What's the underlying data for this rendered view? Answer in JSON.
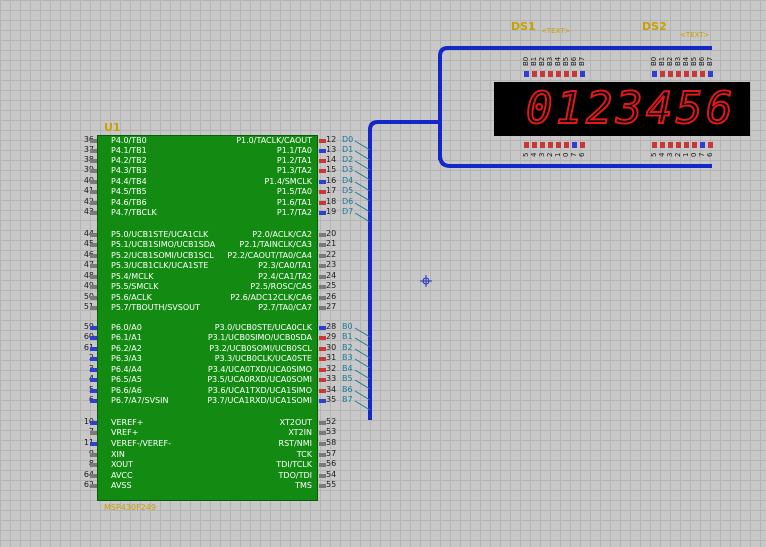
{
  "chip": {
    "ref": "U1",
    "part": "MSP430F249",
    "left_pins": [
      {
        "num": "36",
        "name": "P4.0/TB0",
        "pin": "gray"
      },
      {
        "num": "37",
        "name": "P4.1/TB1",
        "pin": "gray"
      },
      {
        "num": "38",
        "name": "P4.2/TB2",
        "pin": "gray"
      },
      {
        "num": "39",
        "name": "P4.3/TB3",
        "pin": "gray"
      },
      {
        "num": "40",
        "name": "P4.4/TB4",
        "pin": "gray"
      },
      {
        "num": "41",
        "name": "P4.5/TB5",
        "pin": "gray"
      },
      {
        "num": "42",
        "name": "P4.6/TB6",
        "pin": "gray"
      },
      {
        "num": "43",
        "name": "P4.7/TBCLK",
        "pin": "gray"
      },
      {
        "num": "44",
        "name": "P5.0/UCB1STE/UCA1CLK",
        "pin": "gray"
      },
      {
        "num": "45",
        "name": "P5.1/UCB1SIMO/UCB1SDA",
        "pin": "gray"
      },
      {
        "num": "46",
        "name": "P5.2/UCB1SOMI/UCB1SCL",
        "pin": "gray"
      },
      {
        "num": "47",
        "name": "P5.3/UCB1CLK/UCA1STE",
        "pin": "gray"
      },
      {
        "num": "48",
        "name": "P5.4/MCLK",
        "pin": "gray"
      },
      {
        "num": "49",
        "name": "P5.5/SMCLK",
        "pin": "gray"
      },
      {
        "num": "50",
        "name": "P5.6/ACLK",
        "pin": "gray"
      },
      {
        "num": "51",
        "name": "P5.7/TBOUTH/SVSOUT",
        "pin": "gray"
      },
      {
        "num": "59",
        "name": "P6.0/A0",
        "pin": "blue"
      },
      {
        "num": "60",
        "name": "P6.1/A1",
        "pin": "blue"
      },
      {
        "num": "61",
        "name": "P6.2/A2",
        "pin": "blue"
      },
      {
        "num": "2",
        "name": "P6.3/A3",
        "pin": "blue"
      },
      {
        "num": "3",
        "name": "P6.4/A4",
        "pin": "blue"
      },
      {
        "num": "4",
        "name": "P6.5/A5",
        "pin": "blue"
      },
      {
        "num": "5",
        "name": "P6.6/A6",
        "pin": "blue"
      },
      {
        "num": "6",
        "name": "P6.7/A7/SVSIN",
        "pin": "blue"
      },
      {
        "num": "10",
        "name": "VEREF+",
        "pin": "blue"
      },
      {
        "num": "7",
        "name": "VREF+",
        "pin": "gray"
      },
      {
        "num": "11",
        "name": "VEREF-/VEREF-",
        "pin": "blue"
      },
      {
        "num": "9",
        "name": "XIN",
        "pin": "gray"
      },
      {
        "num": "8",
        "name": "XOUT",
        "pin": "gray"
      },
      {
        "num": "64",
        "name": "AVCC",
        "pin": "gray"
      },
      {
        "num": "62",
        "name": "AVSS",
        "pin": "gray"
      }
    ],
    "right_pins": [
      {
        "num": "12",
        "name": "P1.0/TACLK/CAOUT",
        "pin": "red",
        "net": "D0"
      },
      {
        "num": "13",
        "name": "P1.1/TA0",
        "pin": "blue",
        "net": "D1"
      },
      {
        "num": "14",
        "name": "P1.2/TA1",
        "pin": "red",
        "net": "D2"
      },
      {
        "num": "15",
        "name": "P1.3/TA2",
        "pin": "red",
        "net": "D3"
      },
      {
        "num": "16",
        "name": "P1.4/SMCLK",
        "pin": "blue",
        "net": "D4"
      },
      {
        "num": "17",
        "name": "P1.5/TA0",
        "pin": "red",
        "net": "D5"
      },
      {
        "num": "18",
        "name": "P1.6/TA1",
        "pin": "red",
        "net": "D6"
      },
      {
        "num": "19",
        "name": "P1.7/TA2",
        "pin": "blue",
        "net": "D7"
      },
      {
        "num": "20",
        "name": "P2.0/ACLK/CA2",
        "pin": "gray",
        "net": ""
      },
      {
        "num": "21",
        "name": "P2.1/TAINCLK/CA3",
        "pin": "gray",
        "net": ""
      },
      {
        "num": "22",
        "name": "P2.2/CAOUT/TA0/CA4",
        "pin": "gray",
        "net": ""
      },
      {
        "num": "23",
        "name": "P2.3/CA0/TA1",
        "pin": "gray",
        "net": ""
      },
      {
        "num": "24",
        "name": "P2.4/CA1/TA2",
        "pin": "gray",
        "net": ""
      },
      {
        "num": "25",
        "name": "P2.5/ROSC/CA5",
        "pin": "gray",
        "net": ""
      },
      {
        "num": "26",
        "name": "P2.6/ADC12CLK/CA6",
        "pin": "gray",
        "net": ""
      },
      {
        "num": "27",
        "name": "P2.7/TA0/CA7",
        "pin": "gray",
        "net": ""
      },
      {
        "num": "28",
        "name": "P3.0/UCB0STE/UCA0CLK",
        "pin": "blue",
        "net": "B0"
      },
      {
        "num": "29",
        "name": "P3.1/UCB0SIMO/UCB0SDA",
        "pin": "red",
        "net": "B1"
      },
      {
        "num": "30",
        "name": "P3.2/UCB0SOMI/UCB0SCL",
        "pin": "red",
        "net": "B2"
      },
      {
        "num": "31",
        "name": "P3.3/UCB0CLK/UCA0STE",
        "pin": "red",
        "net": "B3"
      },
      {
        "num": "32",
        "name": "P3.4/UCA0TXD/UCA0SIMO",
        "pin": "red",
        "net": "B4"
      },
      {
        "num": "33",
        "name": "P3.5/UCA0RXD/UCA0SOMI",
        "pin": "red",
        "net": "B5"
      },
      {
        "num": "34",
        "name": "P3.6/UCA1TXD/UCA1SIMO",
        "pin": "red",
        "net": "B6"
      },
      {
        "num": "35",
        "name": "P3.7/UCA1RXD/UCA1SOMI",
        "pin": "blue",
        "net": "B7"
      },
      {
        "num": "52",
        "name": "XT2OUT",
        "pin": "gray",
        "net": ""
      },
      {
        "num": "53",
        "name": "XT2IN",
        "pin": "gray",
        "net": ""
      },
      {
        "num": "58",
        "name": "RST/NMI",
        "pin": "gray",
        "net": ""
      },
      {
        "num": "57",
        "name": "TCK",
        "pin": "gray",
        "net": ""
      },
      {
        "num": "56",
        "name": "TDI/TCLK",
        "pin": "gray",
        "net": ""
      },
      {
        "num": "54",
        "name": "TDO/TDI",
        "pin": "gray",
        "net": ""
      },
      {
        "num": "55",
        "name": "TMS",
        "pin": "gray",
        "net": ""
      }
    ]
  },
  "displays": {
    "ds1": {
      "ref": "DS1",
      "sub": "&lt;TEXT&gt;"
    },
    "ds2": {
      "ref": "DS2",
      "sub": "&lt;TEXT&gt;"
    },
    "digits": [
      "0",
      "1",
      "2",
      "3",
      "4",
      "5",
      "6"
    ],
    "top_pins_left": [
      "B0",
      "B1",
      "B2",
      "B3",
      "B4",
      "B5",
      "B6",
      "B7"
    ],
    "top_pins_right": [
      "B0",
      "B1",
      "B2",
      "B3",
      "B4",
      "B5",
      "B6",
      "B7"
    ],
    "bottom_pins_left": [
      "5",
      "4",
      "3",
      "2",
      "1",
      "0",
      "7",
      "6"
    ],
    "bottom_pins_right": [
      "5",
      "4",
      "3",
      "2",
      "1",
      "0",
      "7",
      "6"
    ]
  },
  "colors": {
    "chip": "#138b13",
    "bus": "#1428c8",
    "segment": "#e01818",
    "title": "#c8a000"
  }
}
